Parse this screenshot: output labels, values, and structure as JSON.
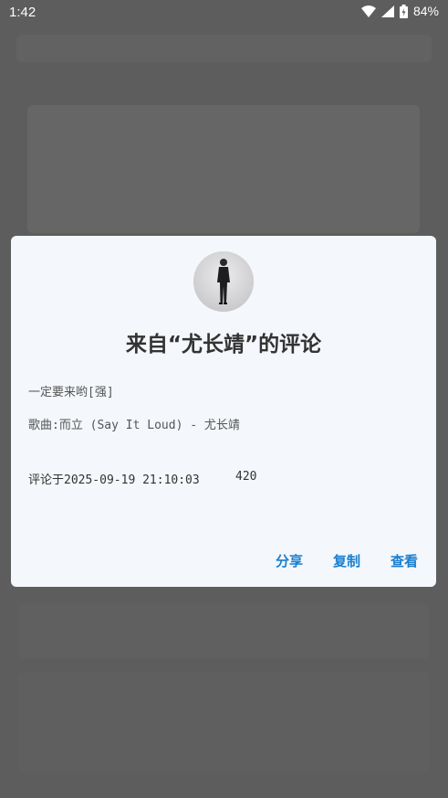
{
  "status_bar": {
    "time": "1:42",
    "battery": "84%"
  },
  "dialog": {
    "title": "来自“尤长靖”的评论",
    "comment": "一定要来哟[强]",
    "song": "歌曲:而立 (Say It Loud) - 尤长靖",
    "date": "评论于2025-09-19  21:10:03",
    "likes": "420",
    "actions": {
      "share": "分享",
      "copy": "复制",
      "view": "查看"
    }
  },
  "colors": {
    "accent": "#1a7fd0",
    "dialog_bg": "#f4f7fb",
    "title": "#333333"
  }
}
